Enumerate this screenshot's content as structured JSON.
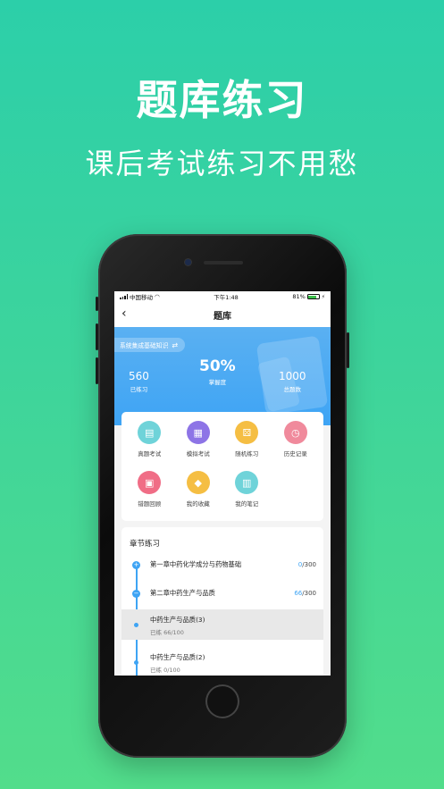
{
  "promo": {
    "headline": "题库练习",
    "subline": "课后考试练习不用愁"
  },
  "status_bar": {
    "carrier": "中国移动",
    "time": "下午1:48",
    "battery": "81%",
    "battery_level": 0.81
  },
  "nav": {
    "title": "题库",
    "back_icon": "chevron-left-icon"
  },
  "banner": {
    "subject": "系统集成基础知识",
    "swap_icon": "swap-icon",
    "stats": {
      "done_value": "560",
      "done_label": "已练习",
      "mastery_value": "50%",
      "mastery_label": "掌握度",
      "total_value": "1000",
      "total_label": "总题数"
    }
  },
  "functions": [
    {
      "label": "真题考试",
      "icon": "exam-book-icon",
      "color": "#6fd3d9"
    },
    {
      "label": "模拟考试",
      "icon": "mock-exam-icon",
      "color": "#8d74e6"
    },
    {
      "label": "随机练习",
      "icon": "dice-icon",
      "color": "#f5be43"
    },
    {
      "label": "历史记录",
      "icon": "history-clock-icon",
      "color": "#f08a9c"
    },
    {
      "label": "错题回顾",
      "icon": "wrong-answer-icon",
      "color": "#f06d86"
    },
    {
      "label": "我的收藏",
      "icon": "favorite-icon",
      "color": "#f5be43"
    },
    {
      "label": "我的笔记",
      "icon": "notes-icon",
      "color": "#6fd3d9"
    }
  ],
  "chapters": {
    "title": "章节练习",
    "items": [
      {
        "name": "第一章中药化学成分与药物基础",
        "current": "0",
        "total": "/300",
        "toggle": "+"
      },
      {
        "name": "第二章中药生产与品质",
        "current": "66",
        "total": "/300",
        "toggle": "−"
      }
    ],
    "sections": [
      {
        "name": "中药生产与品质(3)",
        "progress": "已练 66/100"
      },
      {
        "name": "中药生产与品质(2)",
        "progress": "已练 0/100"
      }
    ]
  },
  "colors": {
    "accent": "#3ea4f4",
    "background_top": "#2ccfa9",
    "background_bottom": "#52dd8b"
  }
}
